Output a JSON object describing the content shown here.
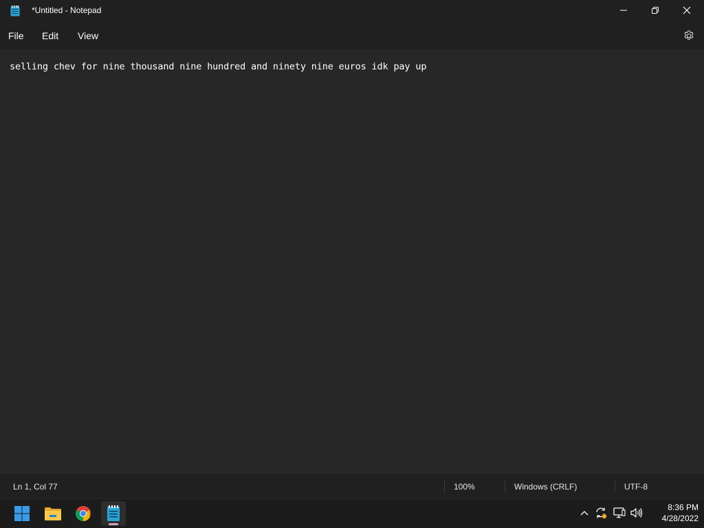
{
  "window": {
    "title": "*Untitled - Notepad"
  },
  "menu": {
    "file": "File",
    "edit": "Edit",
    "view": "View"
  },
  "editor": {
    "content": "selling chev for nine thousand nine hundred and ninety nine euros idk pay up"
  },
  "status": {
    "position": "Ln 1, Col 77",
    "zoom": "100%",
    "line_ending": "Windows (CRLF)",
    "encoding": "UTF-8"
  },
  "taskbar": {
    "apps": [
      "start-icon",
      "file-explorer-icon",
      "chrome-icon",
      "notepad-icon"
    ],
    "tray_icons": [
      "chevron-up-icon",
      "sync-icon",
      "network-icon",
      "volume-icon"
    ],
    "time": "8:36 PM",
    "date": "4/28/2022"
  },
  "colors": {
    "titlebar_bg": "#202020",
    "editor_bg": "#272727",
    "taskbar_bg": "#1c1c1c",
    "start_blue": "#3a9be8",
    "notepad_accent": "#d3a3c8"
  }
}
